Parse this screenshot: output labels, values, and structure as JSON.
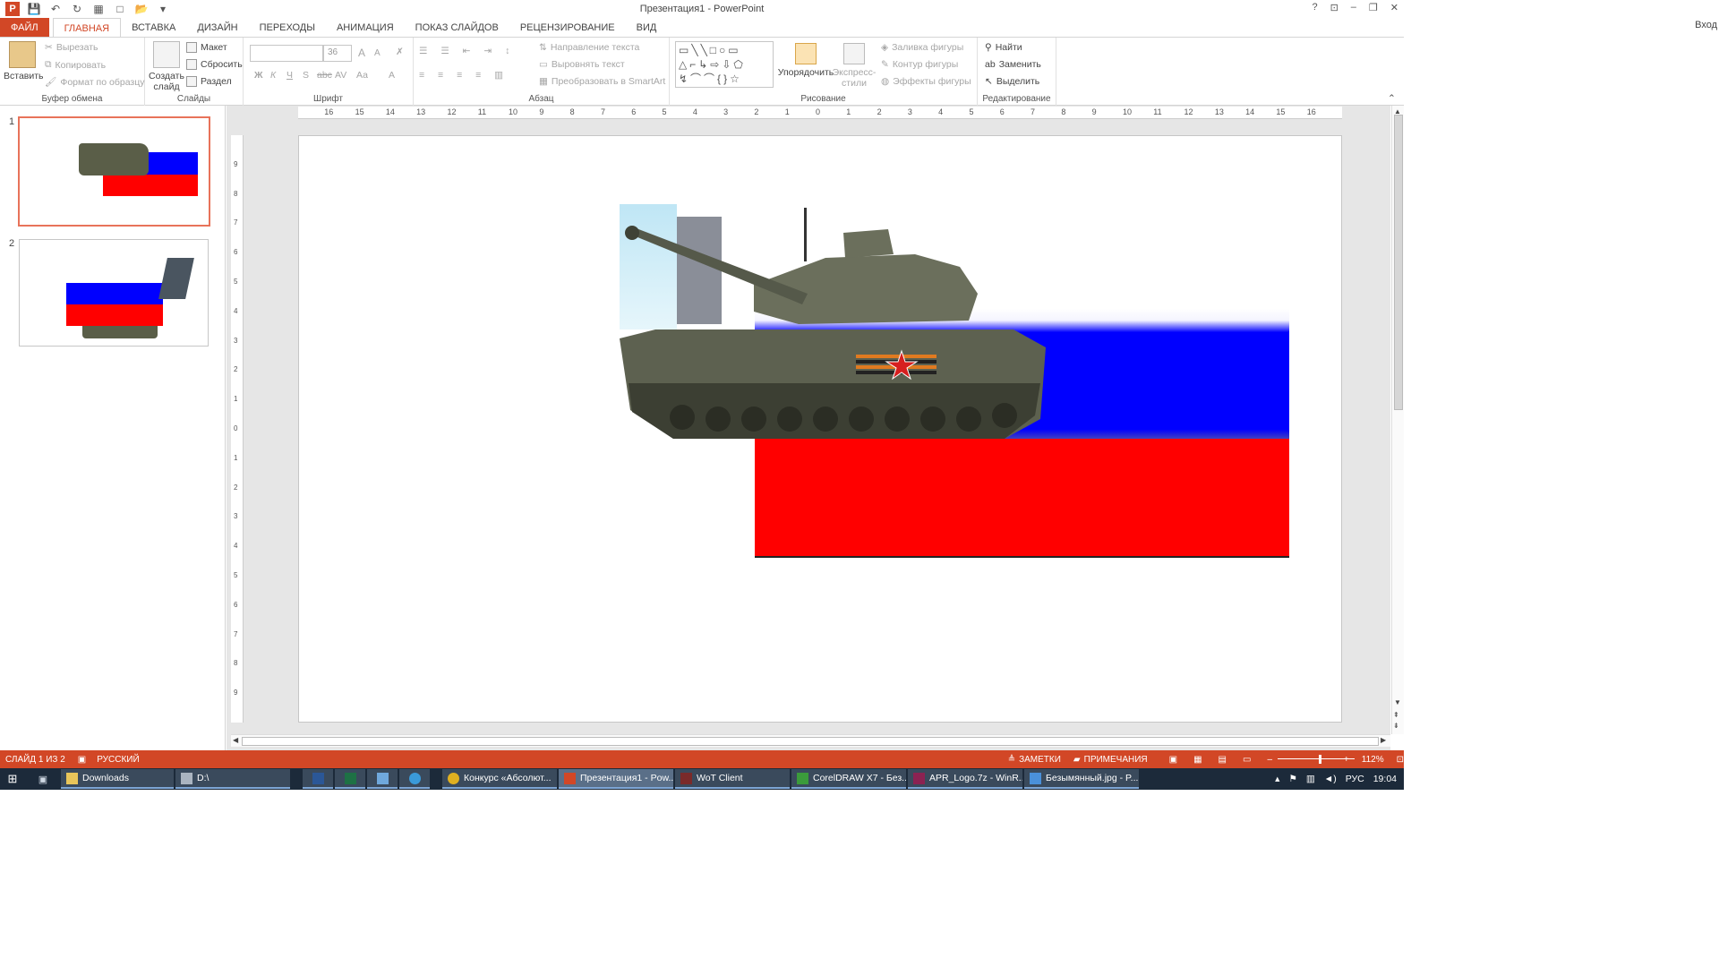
{
  "window": {
    "title": "Презентация1 - PowerPoint",
    "controls": {
      "help": "?",
      "ribbon_opts": "⊡",
      "minimize": "–",
      "restore": "❐",
      "close": "✕"
    },
    "login": "Вход"
  },
  "qat": {
    "icons": [
      "powerpoint-icon",
      "save-icon",
      "undo-icon",
      "redo-icon",
      "present-icon",
      "new-icon",
      "open-icon",
      "customize-icon"
    ]
  },
  "tabs": [
    "ФАЙЛ",
    "ГЛАВНАЯ",
    "ВСТАВКА",
    "ДИЗАЙН",
    "ПЕРЕХОДЫ",
    "АНИМАЦИЯ",
    "ПОКАЗ СЛАЙДОВ",
    "РЕЦЕНЗИРОВАНИЕ",
    "ВИД"
  ],
  "ribbon": {
    "clipboard": {
      "paste": "Вставить",
      "cut": "Вырезать",
      "copy": "Копировать",
      "format_painter": "Формат по образцу",
      "label": "Буфер обмена"
    },
    "slides": {
      "new_slide_1": "Создать",
      "new_slide_2": "слайд",
      "layout": "Макет",
      "reset": "Сбросить",
      "section": "Раздел",
      "label": "Слайды"
    },
    "font": {
      "size": "36",
      "bold": "Ж",
      "italic": "К",
      "underline": "Ч",
      "shadow": "S",
      "strike": "abc",
      "spacing": "AV",
      "case": "Аа",
      "color": "А",
      "grow": "A",
      "shrink": "A",
      "label": "Шрифт"
    },
    "paragraph": {
      "text_direction": "Направление текста",
      "align_text": "Выровнять текст",
      "smartart": "Преобразовать в SmartArt",
      "label": "Абзац"
    },
    "drawing": {
      "arrange": "Упорядочить",
      "quick_styles_1": "Экспресс-",
      "quick_styles_2": "стили",
      "fill": "Заливка фигуры",
      "outline": "Контур фигуры",
      "effects": "Эффекты фигуры",
      "label": "Рисование"
    },
    "editing": {
      "find": "Найти",
      "replace": "Заменить",
      "select": "Выделить",
      "label": "Редактирование"
    }
  },
  "ruler": {
    "h_ticks": [
      "16",
      "15",
      "14",
      "13",
      "12",
      "11",
      "10",
      "9",
      "8",
      "7",
      "6",
      "5",
      "4",
      "3",
      "2",
      "1",
      "0",
      "1",
      "2",
      "3",
      "4",
      "5",
      "6",
      "7",
      "8",
      "9",
      "10",
      "11",
      "12",
      "13",
      "14",
      "15",
      "16"
    ],
    "v_ticks": [
      "9",
      "8",
      "7",
      "6",
      "5",
      "4",
      "3",
      "2",
      "1",
      "0",
      "1",
      "2",
      "3",
      "4",
      "5",
      "6",
      "7",
      "8",
      "9"
    ]
  },
  "thumbnails": [
    {
      "num": "1"
    },
    {
      "num": "2"
    }
  ],
  "statusbar": {
    "slide_info": "СЛАЙД 1 ИЗ 2",
    "language": "РУССКИЙ",
    "notes": "ЗАМЕТКИ",
    "comments": "ПРИМЕЧАНИЯ",
    "zoom": "112%",
    "zoom_level": 0.56
  },
  "taskbar": {
    "items": [
      "Downloads",
      "D:\\",
      "",
      "",
      "",
      "",
      "Конкурс «Абсолют...",
      "Презентация1 - Pow...",
      "WoT Client",
      "CorelDRAW X7 - Без...",
      "APR_Logo.7z - WinR...",
      "Безымянный.jpg - P..."
    ],
    "lang": "РУС",
    "time": "19:04"
  },
  "colors": {
    "accent": "#d24726",
    "flag_blue": "#0000ff",
    "flag_red": "#ff0000",
    "taskbar": "#1c2a3a"
  }
}
